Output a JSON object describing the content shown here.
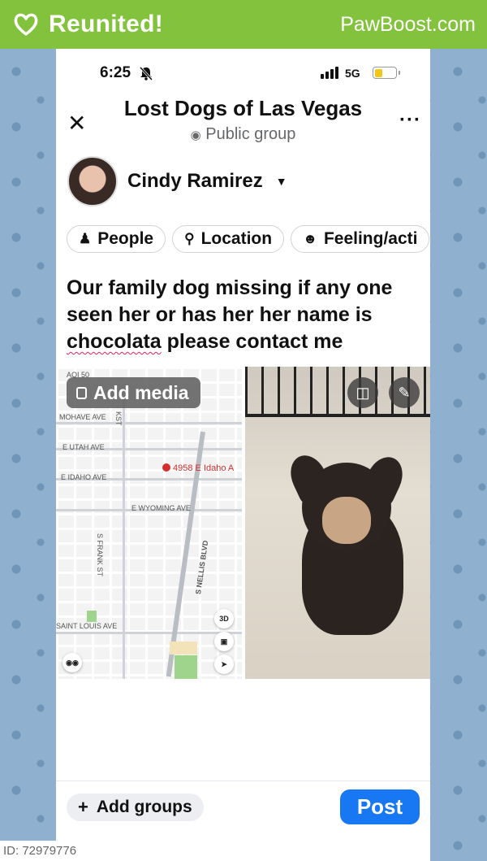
{
  "banner": {
    "title": "Reunited!",
    "site": "PawBoost.com",
    "heart_icon": "heart-outline-icon",
    "color": "#82c23c"
  },
  "status_bar": {
    "time": "6:25",
    "network": "5G"
  },
  "header": {
    "group_name": "Lost Dogs of Las Vegas",
    "privacy": "Public group",
    "close_icon": "close-icon",
    "more_icon": "more-icon"
  },
  "author": {
    "name": "Cindy Ramirez"
  },
  "chips": [
    {
      "label": "People",
      "icon": "people-icon"
    },
    {
      "label": "Location",
      "icon": "location-pin-icon"
    },
    {
      "label": "Feeling/acti",
      "icon": "smile-icon"
    }
  ],
  "post": {
    "text_before": "Our family dog missing if any one seen her or has her her name is ",
    "misspelled": "chocolata",
    "text_after": " please contact me"
  },
  "media": {
    "add_media_label": "Add media",
    "map": {
      "labels": [
        "AQI 50",
        "MOHAVE AVE",
        "E UTAH AVE",
        "E IDAHO AVE",
        "E WYOMING AVE",
        "S FRANK ST",
        "S NELLIS BLVD",
        "SAINT LOUIS AVE",
        "KST"
      ],
      "pin": "4958 E Idaho A",
      "btn_3d": "3D"
    }
  },
  "footer": {
    "add_groups_label": "Add groups",
    "post_label": "Post",
    "post_color": "#1877f2"
  },
  "image_id": "ID: 72979776"
}
